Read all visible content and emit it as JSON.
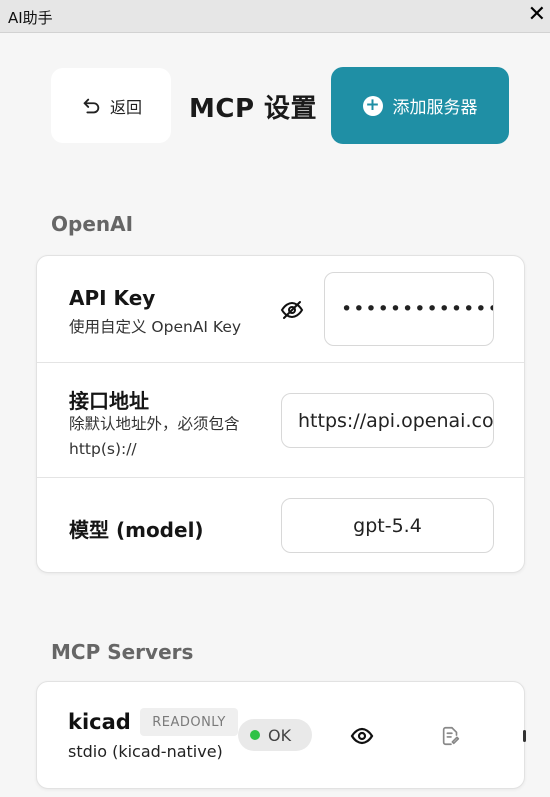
{
  "window": {
    "title": "AI助手",
    "close_glyph": "✕"
  },
  "header": {
    "back_label": "返回",
    "title": "MCP 设置",
    "add_label": "添加服务器",
    "add_color": "#1f8fa5"
  },
  "openai": {
    "section_label": "OpenAI",
    "api_key": {
      "title": "API Key",
      "desc": "使用自定义 OpenAI Key",
      "value": "••••••••••••••••••",
      "icon": "eye-off-icon"
    },
    "endpoint": {
      "title": "接口地址",
      "desc_line1": "除默认地址外，必须包含",
      "desc_line2": "http(s)://",
      "value": "https://api.openai.com"
    },
    "model": {
      "title": "模型 (model)",
      "value": "gpt-5.4"
    }
  },
  "mcp": {
    "section_label": "MCP Servers",
    "servers": [
      {
        "name": "kicad",
        "badge": "READONLY",
        "subtitle": "stdio (kicad-native)",
        "status": "OK",
        "status_color": "#2fc247"
      }
    ]
  }
}
